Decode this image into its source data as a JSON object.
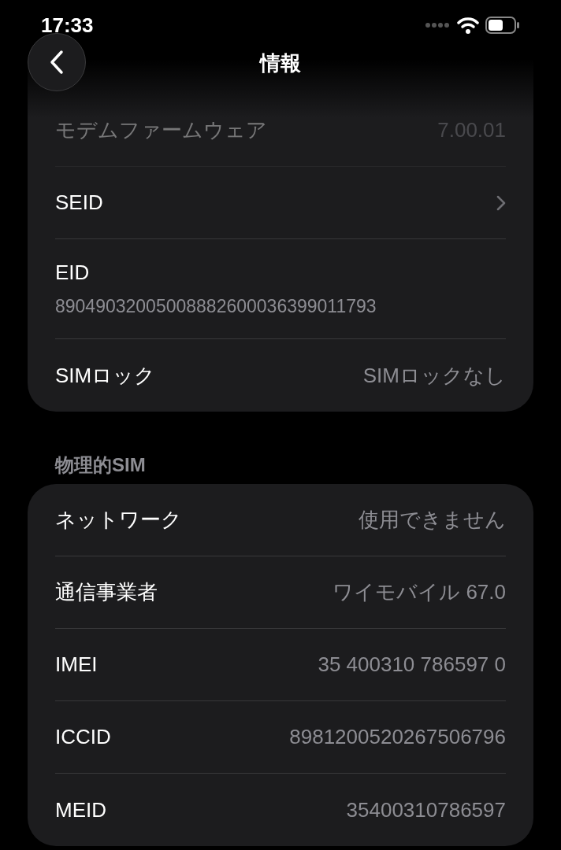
{
  "status_bar": {
    "time": "17:33"
  },
  "nav": {
    "title": "情報"
  },
  "sections": [
    {
      "rows": [
        {
          "kind": "value",
          "label": "モデムファームウェア",
          "value": "7.00.01",
          "faded": true
        },
        {
          "kind": "link",
          "label": "SEID",
          "faded": false
        },
        {
          "kind": "stacked",
          "label": "EID",
          "value": "89049032005008882600036399011793",
          "faded": false
        },
        {
          "kind": "value",
          "label": "SIMロック",
          "value": "SIMロックなし",
          "faded": false
        }
      ]
    },
    {
      "header": "物理的SIM",
      "rows": [
        {
          "kind": "value",
          "label": "ネットワーク",
          "value": "使用できません",
          "faded": false
        },
        {
          "kind": "value",
          "label": "通信事業者",
          "value": "ワイモバイル 67.0",
          "faded": false
        },
        {
          "kind": "value",
          "label": "IMEI",
          "value": "35 400310 786597 0",
          "faded": false
        },
        {
          "kind": "value",
          "label": "ICCID",
          "value": "8981200520267506796",
          "faded": false
        },
        {
          "kind": "value",
          "label": "MEID",
          "value": "35400310786597",
          "faded": false
        }
      ]
    }
  ]
}
